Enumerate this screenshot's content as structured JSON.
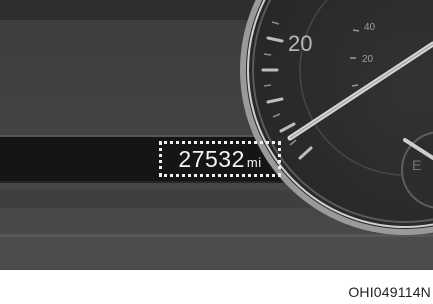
{
  "instrument_cluster": {
    "speedometer_ticks": {
      "large_left": "20",
      "small_top": "40",
      "small_mid": "20"
    },
    "partial_letter": "E"
  },
  "odometer": {
    "value": "27532",
    "unit": "mi"
  },
  "figure_code": "OHI049114N",
  "colors": {
    "background": "#3a3a3a",
    "gauge_face": "#2a2a2a",
    "highlight_box": "#f0f0f0"
  }
}
